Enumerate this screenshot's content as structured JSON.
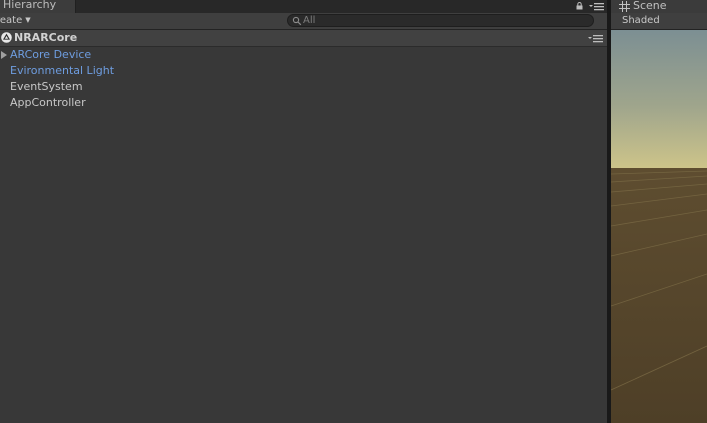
{
  "hierarchy": {
    "tab_label": "Hierarchy",
    "create_label": "reate",
    "create_arrow": "▼",
    "search_placeholder": "All",
    "scene_name": "NRARCore",
    "items": [
      {
        "label": "ARCore Device",
        "style": "prefab",
        "has_foldout": true
      },
      {
        "label": "Evironmental Light",
        "style": "prefab",
        "has_foldout": false
      },
      {
        "label": "EventSystem",
        "style": "normal",
        "has_foldout": false
      },
      {
        "label": "AppController",
        "style": "normal",
        "has_foldout": false
      }
    ]
  },
  "scene_view": {
    "tab_label": "Scene",
    "shading_mode": "Shaded",
    "colors": {
      "sky_top": "#7a8c90",
      "horizon": "#c9c28a",
      "ground": "#5a4a2e"
    }
  },
  "theme": {
    "panel_bg": "#383838",
    "prefab_text": "#6e9de0",
    "normal_text": "#c8c8c8"
  }
}
